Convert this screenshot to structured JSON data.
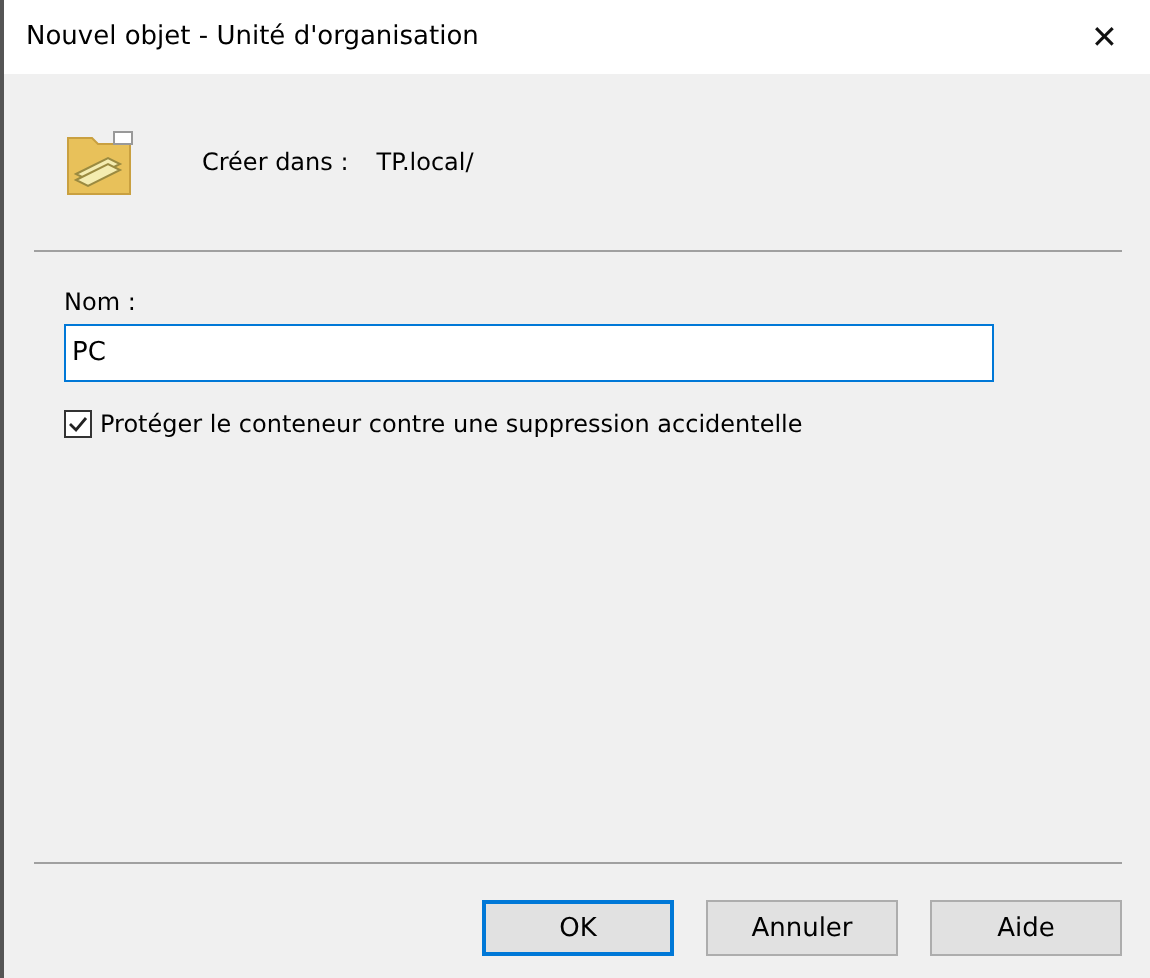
{
  "window": {
    "title": "Nouvel objet - Unité d'organisation",
    "close": "✕"
  },
  "location": {
    "label": "Créer dans :",
    "value": "TP.local/"
  },
  "name_field": {
    "label": "Nom :",
    "value": "PC",
    "focused": true
  },
  "protect": {
    "label": "Protéger le conteneur contre une suppression accidentelle",
    "checked": true
  },
  "buttons": [
    {
      "label": "OK",
      "default": true
    },
    {
      "label": "Annuler",
      "default": false
    },
    {
      "label": "Aide",
      "default": false
    }
  ]
}
